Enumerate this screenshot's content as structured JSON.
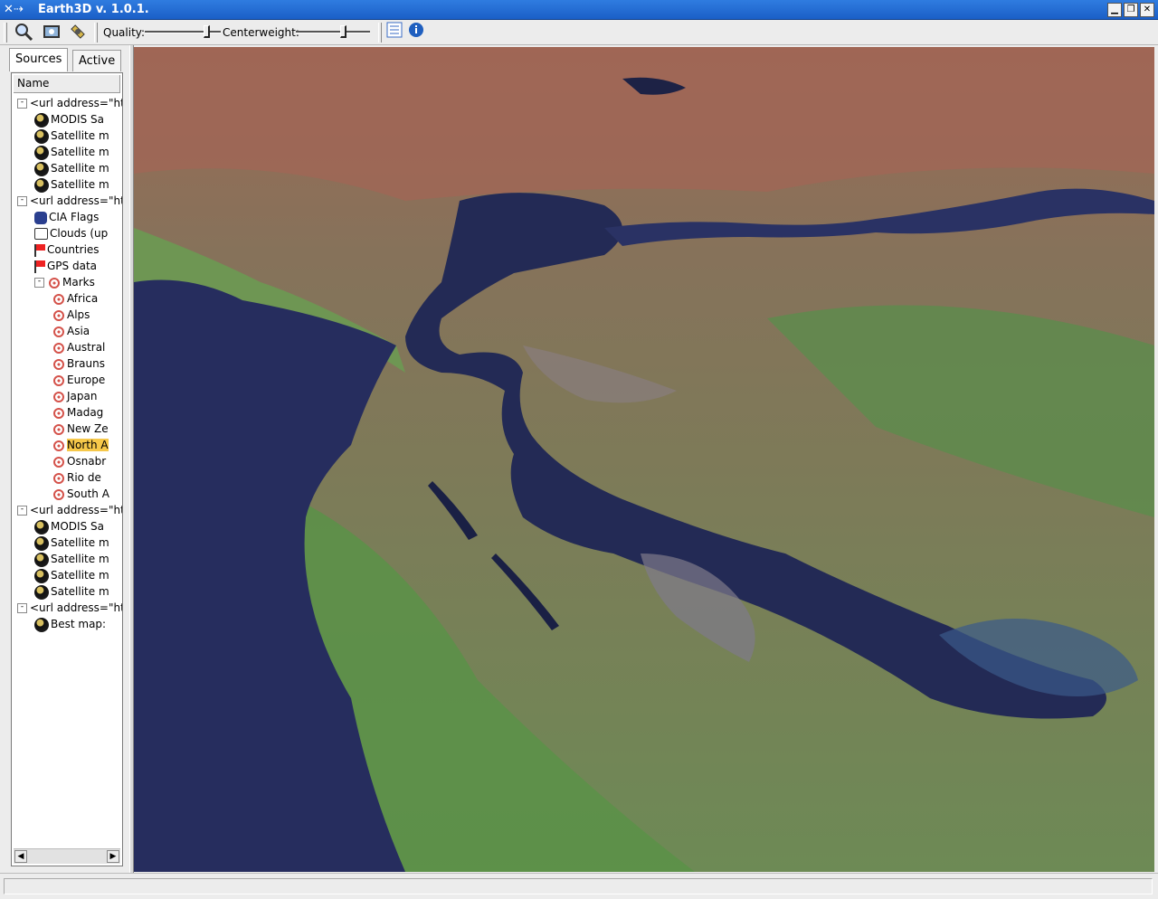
{
  "window": {
    "title": "Earth3D v. 1.0.1."
  },
  "toolbar": {
    "quality_label": "Quality:",
    "quality_value": 0.85,
    "centerweight_label": "Centerweight:",
    "centerweight_value": 0.65
  },
  "tabs": [
    {
      "label": "Sources",
      "active": true
    },
    {
      "label": "Active",
      "active": false
    }
  ],
  "tree": {
    "column_header": "Name",
    "nodes": [
      {
        "label": "<url address=\"ht",
        "icon": "none",
        "toggle": "-"
      },
      {
        "label": "MODIS Sa",
        "icon": "earth-icon"
      },
      {
        "label": "Satellite m",
        "icon": "earth-icon"
      },
      {
        "label": "Satellite m",
        "icon": "earth-icon"
      },
      {
        "label": "Satellite m",
        "icon": "earth-icon"
      },
      {
        "label": "Satellite m",
        "icon": "earth-icon"
      },
      {
        "label": "<url address=\"ht",
        "icon": "none",
        "toggle": "-"
      },
      {
        "label": "CIA Flags",
        "icon": "lock-icon"
      },
      {
        "label": "Clouds (up",
        "icon": "cloud-icon"
      },
      {
        "label": "Countries",
        "icon": "flag-icon"
      },
      {
        "label": "GPS data",
        "icon": "flag-icon"
      },
      {
        "label": "Marks",
        "icon": "mark-icon",
        "toggle": "-"
      },
      {
        "label": "Africa",
        "icon": "mark-icon"
      },
      {
        "label": "Alps",
        "icon": "mark-icon"
      },
      {
        "label": "Asia",
        "icon": "mark-icon"
      },
      {
        "label": "Austral",
        "icon": "mark-icon"
      },
      {
        "label": "Brauns",
        "icon": "mark-icon"
      },
      {
        "label": "Europe",
        "icon": "mark-icon"
      },
      {
        "label": "Japan",
        "icon": "mark-icon"
      },
      {
        "label": "Madag",
        "icon": "mark-icon"
      },
      {
        "label": "New Ze",
        "icon": "mark-icon"
      },
      {
        "label": "North A",
        "icon": "mark-icon",
        "selected": true
      },
      {
        "label": "Osnabr",
        "icon": "mark-icon"
      },
      {
        "label": "Rio de",
        "icon": "mark-icon"
      },
      {
        "label": "South A",
        "icon": "mark-icon"
      },
      {
        "label": "<url address=\"ht",
        "icon": "none",
        "toggle": "-"
      },
      {
        "label": "MODIS Sa",
        "icon": "earth-icon"
      },
      {
        "label": "Satellite m",
        "icon": "earth-icon"
      },
      {
        "label": "Satellite m",
        "icon": "earth-icon"
      },
      {
        "label": "Satellite m",
        "icon": "earth-icon"
      },
      {
        "label": "Satellite m",
        "icon": "earth-icon"
      },
      {
        "label": "<url address=\"ht",
        "icon": "none",
        "toggle": "-"
      },
      {
        "label": "Best map:",
        "icon": "earth-icon"
      }
    ]
  },
  "colors": {
    "titlebar": "#1b5fc7",
    "selection": "#f6c84a",
    "water": "#232a55",
    "land_green": "#5f8a45",
    "land_red": "#9a6450"
  }
}
